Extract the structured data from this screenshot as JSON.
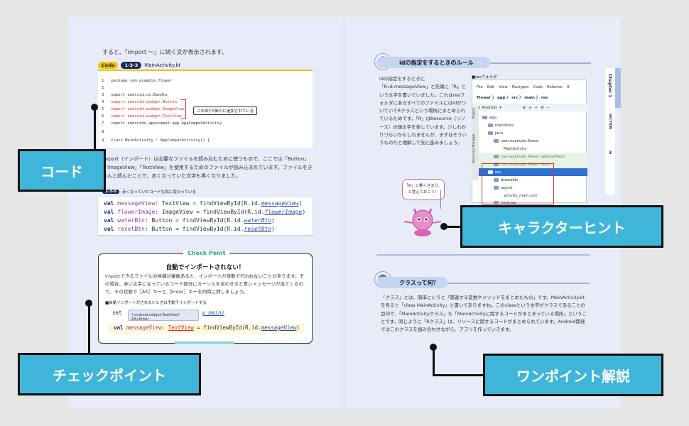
{
  "left": {
    "intro": "すると、「import ～」に続く文が表示されます。",
    "code_tag": "Code",
    "code_num": "1-3-3",
    "code_file": "MainActivity.kt",
    "code_lines": [
      {
        "n": "1",
        "t": "package com.example.flower"
      },
      {
        "n": "2",
        "t": ""
      },
      {
        "n": "3",
        "t": "import android.os.Bundle"
      },
      {
        "n": "4",
        "t": "import android.widget.Button"
      },
      {
        "n": "5",
        "t": "import android.widget.ImageView"
      },
      {
        "n": "6",
        "t": "import android.widget.TextView"
      },
      {
        "n": "7",
        "t": "import androidx.appcompat.app.AppCompatActivity"
      },
      {
        "n": "8",
        "t": ""
      },
      {
        "n": "9",
        "t": "class MainActivity : AppCompatActivity() {"
      }
    ],
    "code_note": "この3行が新たに追加されている",
    "explain": "import（インポート）は必要なファイルを読み込むために使うもので、ここでは「Button」「ImageView」「TextView」を使用するためのファイルが読み込まれています。ファイルをきちんと読んだことで、赤くなっていた文字も黒くなりました。",
    "tip_num": "1-3-5",
    "tip_text": "赤くなっていたコードも気に変わっている",
    "code2": [
      {
        "kw": "val",
        "name": "messageView",
        "rest": ": TextView = findViewById(R.id.",
        "id": "messageView",
        "end": ")"
      },
      {
        "kw": "val",
        "name": "flowerImage",
        "rest": ": ImageView = findViewById(R.id.",
        "id": "flowerImage",
        "end": ")"
      },
      {
        "kw": "val",
        "name": "waterBtn",
        "rest": ": Button = findViewById(R.id.",
        "id": "waterBtn",
        "end": ")"
      },
      {
        "kw": "val",
        "name": "resetBtn",
        "rest": ": Button = findViewById(R.id.",
        "id": "resetBtn",
        "end": ")"
      }
    ],
    "checkpoint": {
      "title": "Check Point",
      "heading": "自動でインポートされない！",
      "body": "importできるファイルの候補が複数あると、インポートが自動で行われないことがあります。その場合、赤い文字になっているコード部分にカーソルを合わせると青いメッセージが出てくるので、その状態で［Alt］キーと［Enter］キーを同時に押しましょう。",
      "sub": "■自動インポートがされないときは手動でインポートする",
      "code_frag": "set",
      "code_frag2": "y_main)",
      "popup": "? android.widget.TextView? Alt+Enter",
      "code_kw": "val",
      "code_name": "messageView",
      "code_type": "TextView",
      "code_rest": " = findViewById(R.id.",
      "code_id": "messageView",
      "code_end": ")"
    }
  },
  "labels": {
    "code": "コード",
    "checkpoint": "チェックポイント",
    "character_hint": "キャラクターヒント",
    "one_point": "ワンポイント解説"
  },
  "right": {
    "section1": "idの指定をするときのルール",
    "section1_text": "idの指定をするときに「R.id.messageView」と先頭に「R」という文字を書いていました。これはresフォルダにあるすべてのファイルにはidがついていてRクラスという場所にまとめられているためです。「R」はResource（リソース）の頭文字を表しています。少しわかりづらいかもしれませんが、まずはそういうものだと理解して先に進みましょう。",
    "res_folder": "■resフォルダ",
    "ide_menu": [
      "File",
      "Edit",
      "View",
      "Navigate",
      "Code",
      "Refactor",
      "B"
    ],
    "ide_breadcrumb": "Flower 〉 app 〉 src 〉 main 〉 res",
    "ide_dropdown": "Android",
    "ide_side1": "Project",
    "ide_side2": "Resource Manager",
    "tree": [
      "app",
      "manifests",
      "java",
      "com.example.flower",
      "MainActivity",
      "com.example.flower (androidTest)",
      "com.example.flower (test)",
      "res",
      "drawable",
      "layout",
      "activity_main.xml",
      "mipmap"
    ],
    "bubble": "「R」と書くきまり、と覚えておこう！",
    "section2": "クラスって何？",
    "section2_text": "「クラス」とは、簡単にいうと「関連する変数やメソッドをまとめたもの」です。MainActivity.ktを見ると「class MainActivity」と書いてありますね。このclassという文字がクラスであることの目印で、「MainActivityクラス」も「MainActivityに関するコードがまとまっている場所」ということです。同じように「Rクラス」は、リソースに関するコードがまとめられています。Android開発ではこのクラスを組み合わせながら、アプリを作っていきます。",
    "chapter": "Chapter 1",
    "section_label": "SECTION",
    "section_num": "3"
  },
  "colors": {
    "label_bg": "#3fb6d9",
    "page_bg": "#e7ecf8",
    "accent_yellow": "#f2c200",
    "navy": "#1e2b55",
    "teal": "#27a391"
  }
}
